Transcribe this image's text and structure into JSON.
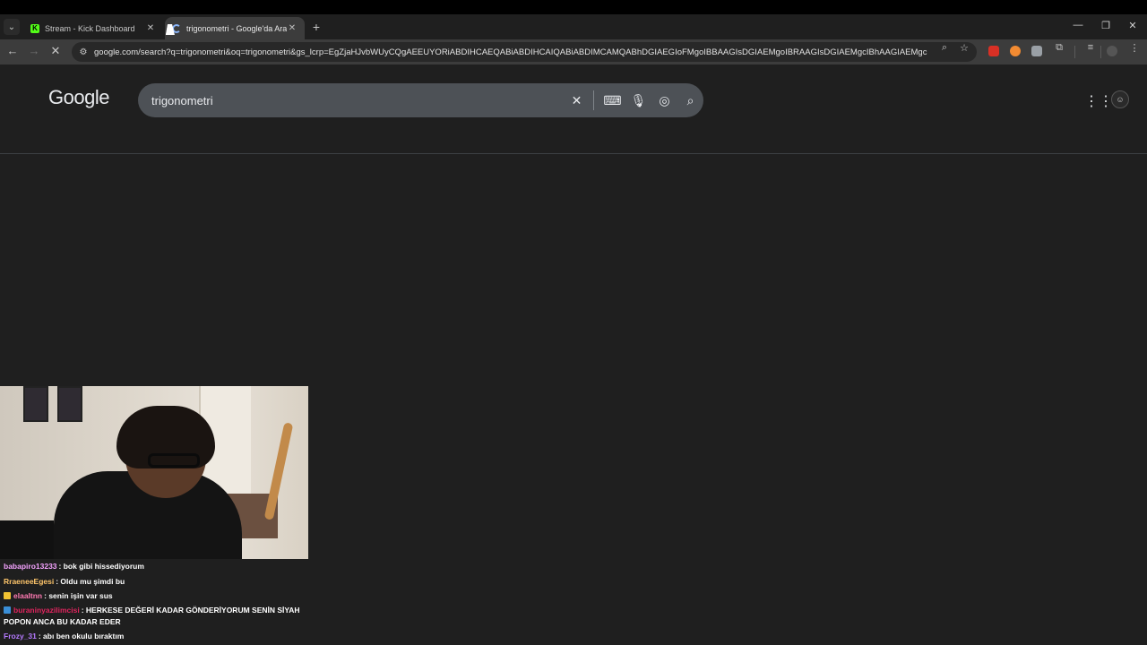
{
  "browser": {
    "tabs": [
      {
        "title": "Stream - Kick Dashboard",
        "favicon": "kick-icon",
        "active": false
      },
      {
        "title": "trigonometri - Google'da Ara",
        "favicon": "loading-icon",
        "active": true
      }
    ],
    "url": "google.com/search?q=trigonometri&oq=trigonometri&gs_lcrp=EgZjaHJvbWUyCQgAEEUYORiABDIHCAEQABiABDIHCAIQABiABDIMCAMQABhDGIAEGIoFMgoIBBAAGIsDGIAEMgoIBRAAGIsDGIAEMgcIBhAAGIAEMgcIBxAAGIAE..."
  },
  "google": {
    "logo": "Google",
    "query": "trigonometri"
  },
  "chat": [
    {
      "user": "babapiro13233",
      "color": "#f5a3ff",
      "message": ": bok gibi hissediyorum",
      "badge": null
    },
    {
      "user": "RraeneeEgesi",
      "color": "#ffc66b",
      "message": ": Oldu mu şimdi bu",
      "badge": null
    },
    {
      "user": "elaaltnn",
      "color": "#ff7ab3",
      "message": ": senin işin var sus",
      "badge": "#f1c232"
    },
    {
      "user": "buraninyazilimcisi",
      "color": "#e0245e",
      "message": ": HERKESE DEĞERİ KADAR GÖNDERİYORUM SENİN SİYAH POPON ANCA BU KADAR EDER",
      "badge": "#3a8fd8"
    },
    {
      "user": "Frozy_31",
      "color": "#b57aff",
      "message": ": abı ben okulu bıraktım",
      "badge": null
    }
  ],
  "colors": {
    "accent": "#8ab4f8",
    "kick": "#53fc18"
  }
}
